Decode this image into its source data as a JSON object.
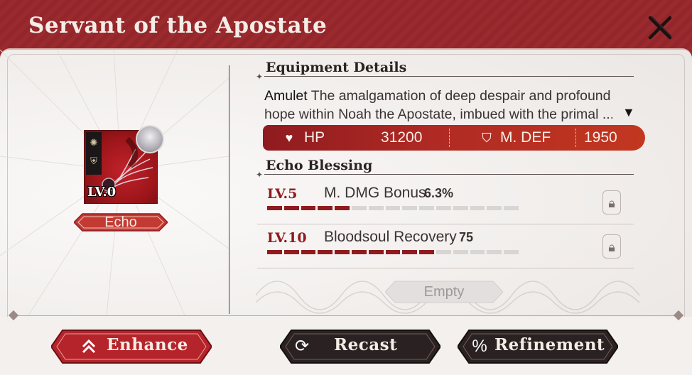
{
  "dialog": {
    "title": "Servant of the Apostate",
    "close_icon": "close-x-icon"
  },
  "item": {
    "level": "LV.0",
    "type_label": "Echo",
    "badges": [
      "sun-emblem-icon",
      "shield-emblem-icon"
    ],
    "portrait_icon": "character-portrait-icon"
  },
  "equipment_details": {
    "heading": "Equipment Details",
    "kind": "Amulet",
    "description_line1": "The amalgamation of deep despair and profound",
    "description_line2": "hope within Noah the Apostate, imbued with the primal ...",
    "expand_icon": "caret-down-icon",
    "stats": [
      {
        "icon": "heart-icon",
        "name": "HP",
        "value": "31200"
      },
      {
        "icon": "shield-icon",
        "name": "M. DEF",
        "value": "1950"
      }
    ]
  },
  "echo_blessing": {
    "heading": "Echo Blessing",
    "rows": [
      {
        "level": "LV.5",
        "name": "M. DMG Bonus",
        "value": "6.3%",
        "progress_filled": 5,
        "progress_total": 15,
        "lock_icon": "lock-icon"
      },
      {
        "level": "LV.10",
        "name": "Bloodsoul Recovery",
        "value": "75",
        "progress_filled": 10,
        "progress_total": 15,
        "lock_icon": "lock-icon"
      }
    ],
    "empty_label": "Empty"
  },
  "actions": {
    "enhance": {
      "label": "Enhance",
      "icon": "double-chevron-up-icon"
    },
    "recast": {
      "label": "Recast",
      "icon": "refresh-arrows-icon"
    },
    "refinement": {
      "label": "Refinement",
      "icon": "percent-icon"
    }
  },
  "colors": {
    "title_bar": "#8e2428",
    "accent_red": "#8f1b1f",
    "panel_bg": "#f1eeec",
    "stat_bar": "#b02a24",
    "dark_button": "#2a2222"
  }
}
